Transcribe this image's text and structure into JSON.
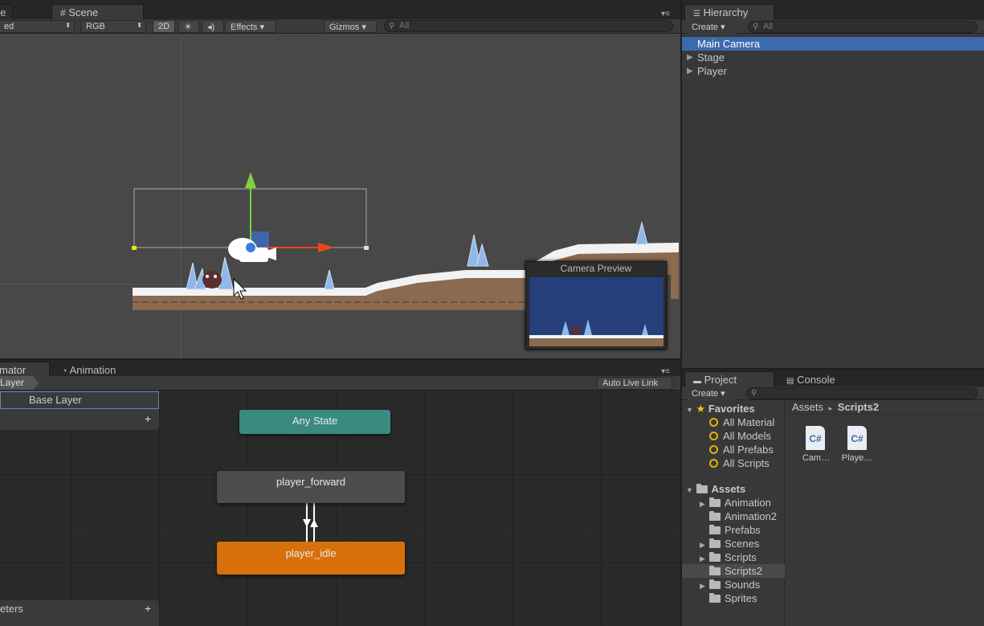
{
  "scene_panel": {
    "tab_partial": "ne",
    "tab_scene": "Scene",
    "toolbar": {
      "shading_partial": "ed",
      "render_mode": "RGB",
      "btn_2d": "2D",
      "effects": "Effects",
      "gizmos": "Gizmos",
      "search_placeholder": "All"
    },
    "camera_preview_title": "Camera Preview"
  },
  "hierarchy_panel": {
    "tab": "Hierarchy",
    "create": "Create",
    "search_placeholder": "All",
    "items": [
      {
        "label": "Main Camera",
        "selected": true,
        "expandable": false
      },
      {
        "label": "Stage",
        "selected": false,
        "expandable": true
      },
      {
        "label": "Player",
        "selected": false,
        "expandable": true
      }
    ]
  },
  "animator_panel": {
    "tab_animator_partial": "mator",
    "tab_animation": "Animation",
    "layer_breadcrumb_partial": "Layer",
    "auto_live_link": "Auto Live Link",
    "layers_list": {
      "base_layer": "Base Layer",
      "add": "+"
    },
    "parameters_partial": "eters",
    "parameters_add": "+",
    "states": {
      "any_state": "Any State",
      "player_forward": "player_forward",
      "player_idle": "player_idle"
    },
    "colors": {
      "any_state": "#3a8a82",
      "default_state": "#d7700a",
      "normal_state": "#4a4c4e"
    }
  },
  "project_panel": {
    "tab_project": "Project",
    "tab_console": "Console",
    "create": "Create",
    "breadcrumb": {
      "root": "Assets",
      "sep": "▸",
      "current": "Scripts2"
    },
    "favorites": {
      "label": "Favorites",
      "items": [
        "All Material",
        "All Models",
        "All Prefabs",
        "All Scripts"
      ]
    },
    "assets": {
      "label": "Assets",
      "folders": [
        {
          "label": "Animation",
          "expandable": true,
          "selected": false
        },
        {
          "label": "Animation2",
          "expandable": false,
          "selected": false
        },
        {
          "label": "Prefabs",
          "expandable": false,
          "selected": false
        },
        {
          "label": "Scenes",
          "expandable": true,
          "selected": false
        },
        {
          "label": "Scripts",
          "expandable": true,
          "selected": false
        },
        {
          "label": "Scripts2",
          "expandable": false,
          "selected": true
        },
        {
          "label": "Sounds",
          "expandable": true,
          "selected": false
        },
        {
          "label": "Sprites",
          "expandable": false,
          "selected": false
        }
      ]
    },
    "files": [
      {
        "label": "Cam…",
        "icon": "C#"
      },
      {
        "label": "Playe…",
        "icon": "C#"
      }
    ]
  }
}
